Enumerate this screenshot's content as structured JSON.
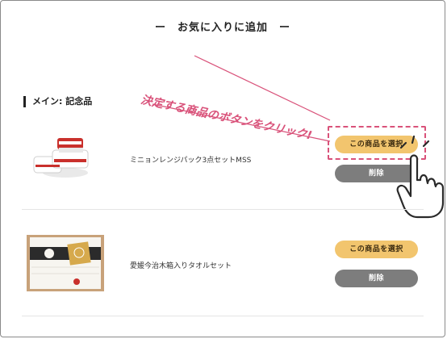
{
  "page": {
    "title": "ー　お気に入りに追加　ー"
  },
  "section": {
    "label": "メイン: 記念品"
  },
  "annotation": {
    "text": "決定する商品のボタンをクリック!"
  },
  "products": [
    {
      "name": "ミニョンレンジパック3点セットMSS",
      "select_label": "この商品を選択",
      "delete_label": "削除"
    },
    {
      "name": "愛媛今治木箱入りタオルセット",
      "select_label": "この商品を選択",
      "delete_label": "削除"
    }
  ],
  "colors": {
    "select_button": "#f2c56e",
    "delete_button": "#7d7d7d",
    "annotation": "#d9527a"
  }
}
